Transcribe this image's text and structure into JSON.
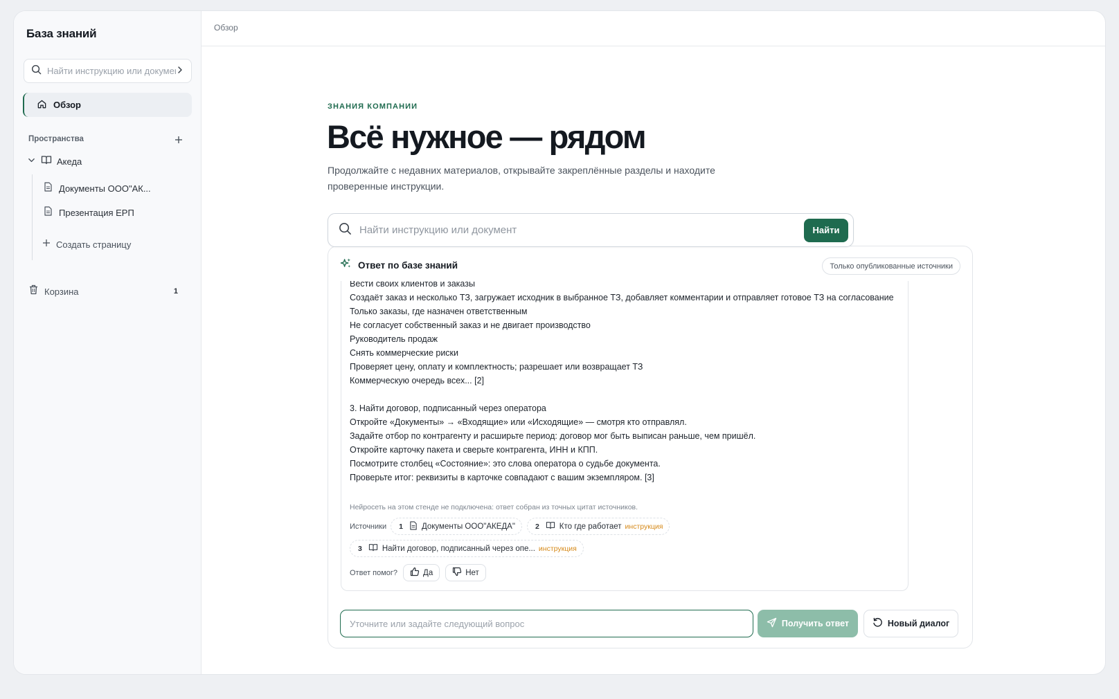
{
  "sidebar": {
    "brand": "База знаний",
    "search_placeholder": "Найти инструкцию или документ",
    "overview_label": "Обзор",
    "spaces_title": "Пространства",
    "space": {
      "label": "Акеда"
    },
    "pages": [
      {
        "label": "Документы ООО\"АК..."
      },
      {
        "label": "Презентация ЕРП"
      }
    ],
    "create_label": "Создать страницу",
    "trash": {
      "label": "Корзина",
      "count": "1"
    }
  },
  "topbar": {
    "breadcrumb": "Обзор"
  },
  "hero": {
    "eyebrow": "ЗНАНИЯ КОМПАНИИ",
    "title": "Всё нужное — рядом",
    "subtitle": "Продолжайте с недавних материалов, открывайте закреплённые разделы и находите проверенные инструкции."
  },
  "search": {
    "placeholder": "Найти инструкцию или документ",
    "button": "Найти"
  },
  "answer": {
    "title": "Ответ по базе знаний",
    "badge": "Только опубликованные источники",
    "lines": [
      "Вести своих клиентов и заказы",
      "Создаёт заказ и несколько ТЗ, загружает исходник в выбранное ТЗ, добавляет комментарии и отправляет готовое ТЗ на согласование",
      "Только заказы, где назначен ответственным",
      "Не согласует собственный заказ и не двигает производство",
      "Руководитель продаж",
      "Снять коммерческие риски",
      "Проверяет цену, оплату и комплектность; разрешает или возвращает ТЗ",
      "Коммерческую очередь всех... [2]",
      "",
      "3. Найти договор, подписанный через оператора",
      "Откройте «Документы» → «Входящие» или «Исходящие» — смотря кто отправлял.",
      "Задайте отбор по контрагенту и расширьте период: договор мог быть выписан раньше, чем пришёл.",
      "Откройте карточку пакета и сверьте контрагента, ИНН и КПП.",
      "Посмотрите столбец «Состояние»: это слова оператора о судьбе документа.",
      "Проверьте итог: реквизиты в карточке совпадают с вашим экземпляром. [3]"
    ],
    "note": "Нейросеть на этом стенде не подключена: ответ собран из точных цитат источников.",
    "sources_label": "Источники",
    "sources": [
      {
        "num": "1",
        "label": "Документы ООО\"АКЕДА\"",
        "tag": "",
        "icon": "document-icon"
      },
      {
        "num": "2",
        "label": "Кто где работает",
        "tag": "инструкция",
        "icon": "book-icon"
      },
      {
        "num": "3",
        "label": "Найти договор, подписанный через опе...",
        "tag": "инструкция",
        "icon": "book-icon"
      }
    ],
    "feedback_question": "Ответ помог?",
    "yes_label": "Да",
    "no_label": "Нет"
  },
  "followup": {
    "placeholder": "Уточните или задайте следующий вопрос",
    "submit_label": "Получить ответ",
    "new_dialog_label": "Новый диалог"
  },
  "colors": {
    "accent": "#1f6b4f",
    "accent_disabled": "#8dbda9",
    "tag": "#d68a1a"
  }
}
